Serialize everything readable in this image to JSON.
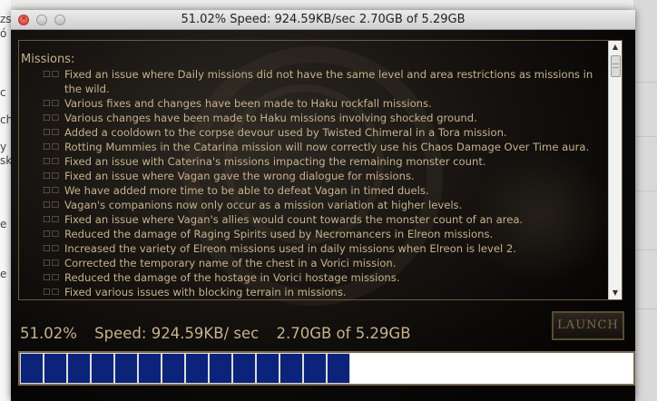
{
  "window": {
    "title": "51.02%  Speed: 924.59KB/sec  2.70GB of 5.29GB"
  },
  "patch_notes": {
    "heading": "Missions:",
    "bullet_mark": "□□",
    "items": [
      "Fixed an issue where Daily missions did not have the same level and area restrictions as missions in the wild.",
      "Various fixes and changes have been made to Haku rockfall missions.",
      "Various changes have been made to Haku missions involving shocked ground.",
      "Added a cooldown to the corpse devour used by Twisted Chimeral in a Tora mission.",
      "Rotting Mummies in the Catarina mission will now correctly use his Chaos Damage Over Time aura.",
      "Fixed an issue with Caterina's missions impacting the remaining monster count.",
      "Fixed an issue where Vagan gave the wrong dialogue for missions.",
      "We have added more time to be able to defeat Vagan in timed duels.",
      "Vagan's companions now only occur as a mission variation at higher levels.",
      "Fixed an issue where Vagan's allies would count towards the monster count of an area.",
      "Reduced the damage of Raging Spirits used by Necromancers in Elreon missions.",
      "Increased the variety of Elreon missions used in daily missions when Elreon is level 2.",
      "Corrected the temporary name of the chest in a Vorici mission.",
      "Reduced the damage of the hostage in Vorici hostage missions.",
      "Fixed various issues with blocking terrain in missions."
    ]
  },
  "status": {
    "percent": "51.02%",
    "speed": "Speed: 924.59KB/ sec",
    "size": "2.70GB of 5.29GB"
  },
  "launch_button": {
    "label": "LAUNCH",
    "enabled": false
  },
  "progress": {
    "fraction": 0.5102,
    "bar_color": "#0b237a"
  },
  "colors": {
    "text": "#c6b28d",
    "border": "#6b5a3c"
  }
}
